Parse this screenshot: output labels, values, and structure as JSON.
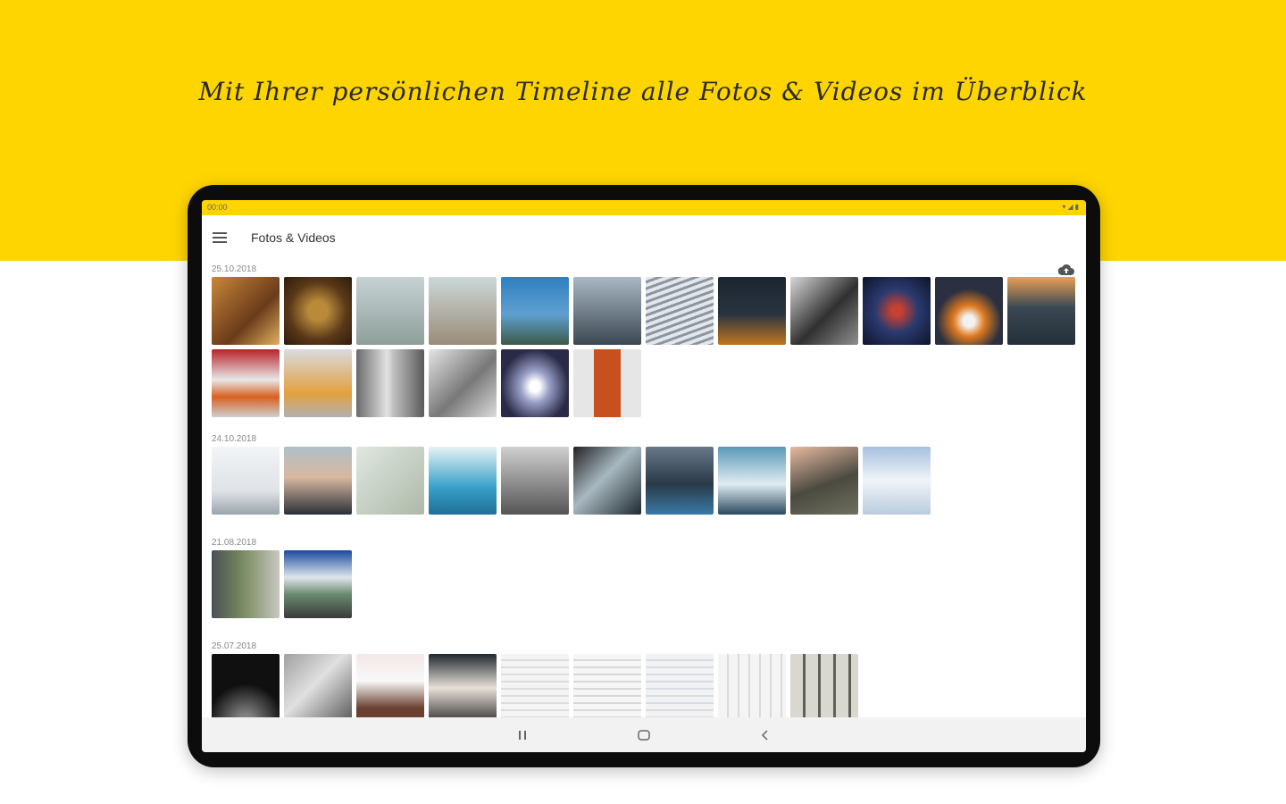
{
  "headline": "Mit Ihrer persönlichen Timeline alle Fotos & Videos im Überblick",
  "status": {
    "time": "00:00",
    "icons": "▾◢▮"
  },
  "appbar": {
    "title": "Fotos & Videos"
  },
  "icons": {
    "menu": "menu-icon",
    "cloud": "cloud-upload-icon",
    "recents": "recents-icon",
    "home": "home-icon",
    "back": "back-icon"
  },
  "colors": {
    "accent": "#FFD500"
  },
  "sections": [
    {
      "date": "25.10.2018",
      "count": 18
    },
    {
      "date": "24.10.2018",
      "count": 10
    },
    {
      "date": "21.08.2018",
      "count": 2
    },
    {
      "date": "25.07.2018",
      "count": 9
    }
  ]
}
